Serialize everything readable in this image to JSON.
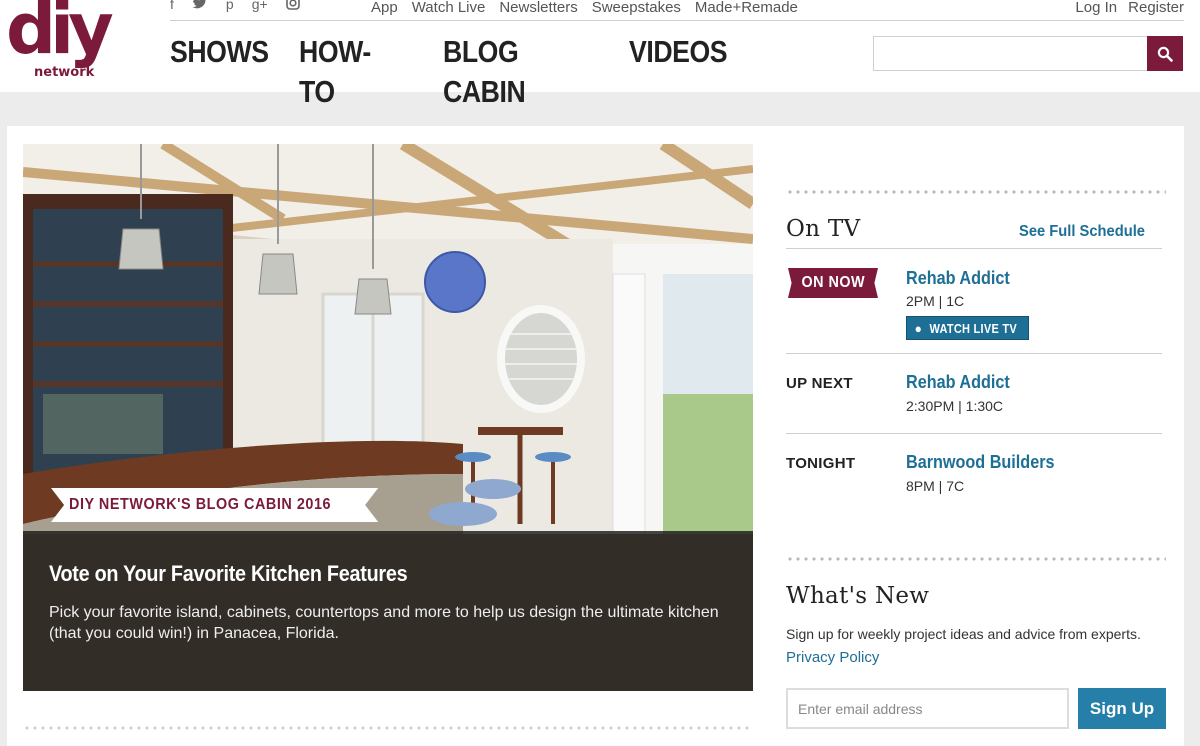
{
  "brand": {
    "logo_main": "diy",
    "logo_sub": "network",
    "color": "#7b1a3a"
  },
  "social_icons": [
    "facebook-icon",
    "twitter-icon",
    "pinterest-icon",
    "google-plus-icon",
    "instagram-icon"
  ],
  "utility_nav": [
    "App",
    "Watch Live",
    "Newsletters",
    "Sweepstakes",
    "Made+Remade"
  ],
  "auth": {
    "login": "Log In",
    "register": "Register"
  },
  "main_nav": [
    "SHOWS",
    "HOW-TO",
    "BLOG CABIN",
    "VIDEOS"
  ],
  "search": {
    "placeholder": "",
    "icon": "search-icon"
  },
  "hero": {
    "tag": "DIY NETWORK'S BLOG CABIN 2016",
    "title": "Vote on Your Favorite Kitchen Features",
    "description": "Pick your favorite island, cabinets, countertops and more to help us design the ultimate kitchen (that you could win!) in Panacea, Florida."
  },
  "on_tv": {
    "heading": "On TV",
    "see_full": "See Full Schedule",
    "on_now": {
      "label": "ON NOW",
      "show": "Rehab Addict",
      "time": "2PM | 1C",
      "watch_label": "WATCH LIVE TV"
    },
    "up_next": {
      "label": "UP NEXT",
      "show": "Rehab Addict",
      "time": "2:30PM | 1:30C"
    },
    "tonight": {
      "label": "TONIGHT",
      "show": "Barnwood Builders",
      "time": "8PM | 7C"
    }
  },
  "whats_new": {
    "heading": "What's New",
    "text": "Sign up for weekly project ideas and advice from experts.",
    "privacy": "Privacy Policy",
    "email_placeholder": "Enter email address",
    "signup_label": "Sign Up"
  },
  "colors": {
    "accent": "#7b1a3a",
    "link": "#1e6f96",
    "button": "#267fa8"
  }
}
